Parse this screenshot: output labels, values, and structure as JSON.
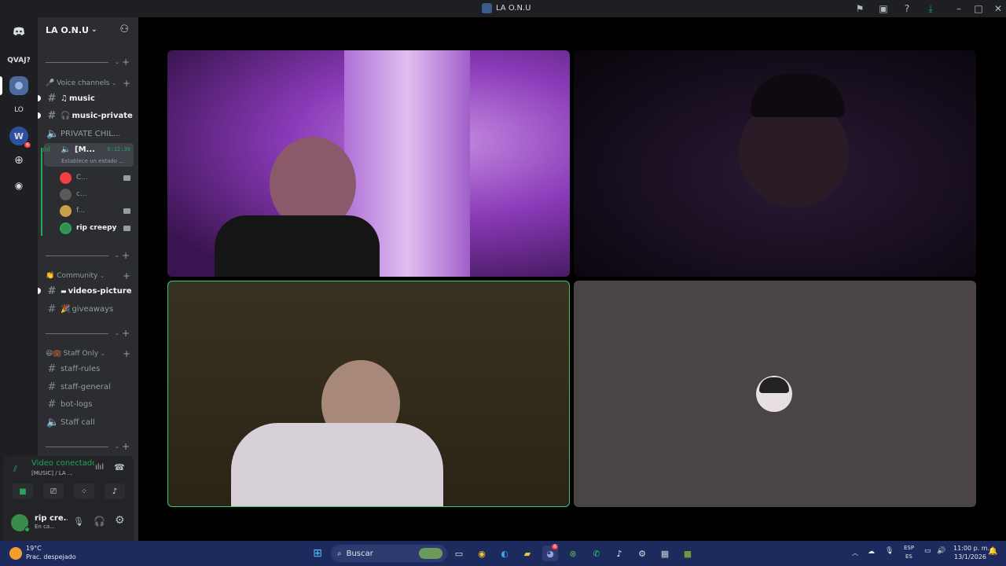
{
  "window": {
    "title": "LA O.N.U"
  },
  "rail": {
    "items": [
      {
        "label": "QVAJ?"
      },
      {
        "label": "LO"
      },
      {
        "badge": "6"
      }
    ]
  },
  "server": {
    "name": "LA O.N.U"
  },
  "categories": {
    "voice": "Voice channels",
    "community": "Community",
    "staff": "Staff Only"
  },
  "channels": {
    "music": "music",
    "music_private": "music-private",
    "private_chill": "PRIVATE CHIL...",
    "active_voice": "[M...",
    "active_timer": "6:12:38",
    "active_status": "Establece un estado ...",
    "videos_picture": "videos-picture",
    "giveaways": "giveaways",
    "staff_rules": "staff-rules",
    "staff_general": "staff-general",
    "bot_logs": "bot-logs",
    "staff_call": "Staff call"
  },
  "voice_users": [
    {
      "name": "C..."
    },
    {
      "name": "c..."
    },
    {
      "name": "f..."
    },
    {
      "name": "rip creepy"
    }
  ],
  "voice_panel": {
    "status": "Video conectado",
    "channel": "[MUSIC] / LA ..."
  },
  "user": {
    "name": "rip cre...",
    "status": "En ca..."
  },
  "taskbar": {
    "weather_temp": "19°C",
    "weather_desc": "Prac. despejado",
    "search": "Buscar",
    "lang": "ESP",
    "lang2": "ES",
    "time": "11:00 p. m.",
    "date": "13/1/2026",
    "discord_badge": "6"
  },
  "colors": {
    "accent": "#23a55a",
    "bg": "#2b2d31",
    "taskbar": "#1d2a5e"
  }
}
